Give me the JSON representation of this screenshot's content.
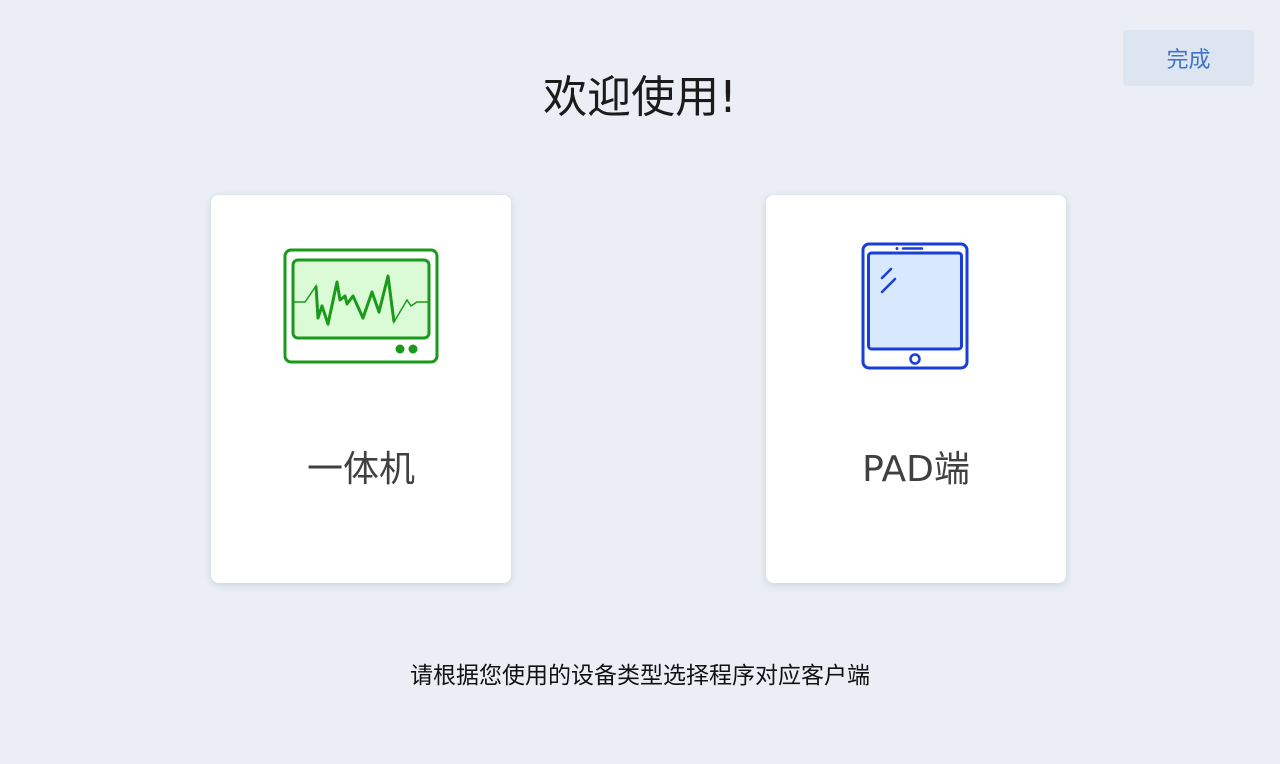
{
  "header": {
    "title": "欢迎使用!",
    "done_label": "完成"
  },
  "cards": [
    {
      "label": "一体机",
      "icon": "monitor-icon",
      "color": "#1a9a1a"
    },
    {
      "label": "PAD端",
      "icon": "tablet-icon",
      "color": "#1a3fd6"
    }
  ],
  "footer": {
    "instruction": "请根据您使用的设备类型选择程序对应客户端"
  },
  "colors": {
    "background": "#ebeff5",
    "done_button_bg": "#dde5f1",
    "done_button_text": "#3f73c8"
  }
}
